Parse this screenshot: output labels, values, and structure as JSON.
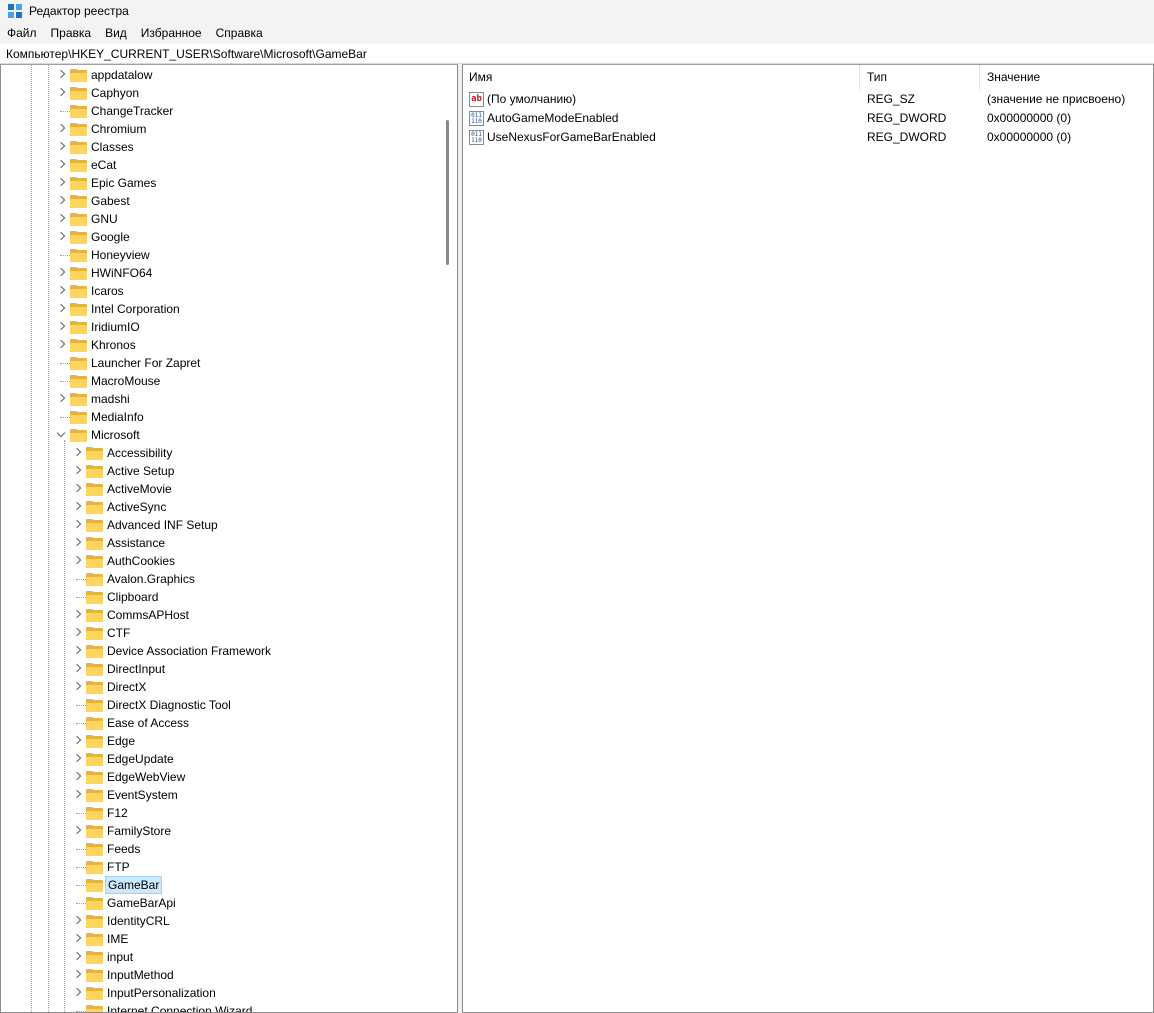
{
  "window": {
    "title": "Редактор реестра"
  },
  "menu": [
    "Файл",
    "Правка",
    "Вид",
    "Избранное",
    "Справка"
  ],
  "address": "Компьютер\\HKEY_CURRENT_USER\\Software\\Microsoft\\GameBar",
  "tree": {
    "top_level": [
      {
        "label": "appdatalow",
        "expander": "collapsed"
      },
      {
        "label": "Caphyon",
        "expander": "collapsed"
      },
      {
        "label": "ChangeTracker",
        "expander": "none"
      },
      {
        "label": "Chromium",
        "expander": "collapsed"
      },
      {
        "label": "Classes",
        "expander": "collapsed"
      },
      {
        "label": "eCat",
        "expander": "collapsed"
      },
      {
        "label": "Epic Games",
        "expander": "collapsed"
      },
      {
        "label": "Gabest",
        "expander": "collapsed"
      },
      {
        "label": "GNU",
        "expander": "collapsed"
      },
      {
        "label": "Google",
        "expander": "collapsed"
      },
      {
        "label": "Honeyview",
        "expander": "none"
      },
      {
        "label": "HWiNFO64",
        "expander": "collapsed"
      },
      {
        "label": "Icaros",
        "expander": "collapsed"
      },
      {
        "label": "Intel Corporation",
        "expander": "collapsed"
      },
      {
        "label": "IridiumIO",
        "expander": "collapsed"
      },
      {
        "label": "Khronos",
        "expander": "collapsed"
      },
      {
        "label": "Launcher For Zapret",
        "expander": "none"
      },
      {
        "label": "MacroMouse",
        "expander": "none"
      },
      {
        "label": "madshi",
        "expander": "collapsed"
      },
      {
        "label": "MediaInfo",
        "expander": "none"
      },
      {
        "label": "Microsoft",
        "expander": "expanded"
      }
    ],
    "microsoft_children": [
      {
        "label": "Accessibility",
        "expander": "collapsed"
      },
      {
        "label": "Active Setup",
        "expander": "collapsed"
      },
      {
        "label": "ActiveMovie",
        "expander": "collapsed"
      },
      {
        "label": "ActiveSync",
        "expander": "collapsed"
      },
      {
        "label": "Advanced INF Setup",
        "expander": "collapsed"
      },
      {
        "label": "Assistance",
        "expander": "collapsed"
      },
      {
        "label": "AuthCookies",
        "expander": "collapsed"
      },
      {
        "label": "Avalon.Graphics",
        "expander": "none"
      },
      {
        "label": "Clipboard",
        "expander": "none"
      },
      {
        "label": "CommsAPHost",
        "expander": "collapsed"
      },
      {
        "label": "CTF",
        "expander": "collapsed"
      },
      {
        "label": "Device Association Framework",
        "expander": "collapsed"
      },
      {
        "label": "DirectInput",
        "expander": "collapsed"
      },
      {
        "label": "DirectX",
        "expander": "collapsed"
      },
      {
        "label": "DirectX Diagnostic Tool",
        "expander": "none"
      },
      {
        "label": "Ease of Access",
        "expander": "none"
      },
      {
        "label": "Edge",
        "expander": "collapsed"
      },
      {
        "label": "EdgeUpdate",
        "expander": "collapsed"
      },
      {
        "label": "EdgeWebView",
        "expander": "collapsed"
      },
      {
        "label": "EventSystem",
        "expander": "collapsed"
      },
      {
        "label": "F12",
        "expander": "none"
      },
      {
        "label": "FamilyStore",
        "expander": "collapsed"
      },
      {
        "label": "Feeds",
        "expander": "none"
      },
      {
        "label": "FTP",
        "expander": "none"
      },
      {
        "label": "GameBar",
        "expander": "none",
        "selected": true
      },
      {
        "label": "GameBarApi",
        "expander": "none"
      },
      {
        "label": "IdentityCRL",
        "expander": "collapsed"
      },
      {
        "label": "IME",
        "expander": "collapsed"
      },
      {
        "label": "input",
        "expander": "collapsed"
      },
      {
        "label": "InputMethod",
        "expander": "collapsed"
      },
      {
        "label": "InputPersonalization",
        "expander": "collapsed"
      },
      {
        "label": "Internet Connection Wizard",
        "expander": "none"
      }
    ]
  },
  "list": {
    "columns": [
      "Имя",
      "Тип",
      "Значение"
    ],
    "rows": [
      {
        "icon": "string-value-icon",
        "name": "(По умолчанию)",
        "type": "REG_SZ",
        "value": "(значение не присвоено)"
      },
      {
        "icon": "dword-value-icon",
        "name": "AutoGameModeEnabled",
        "type": "REG_DWORD",
        "value": "0x00000000 (0)"
      },
      {
        "icon": "dword-value-icon",
        "name": "UseNexusForGameBarEnabled",
        "type": "REG_DWORD",
        "value": "0x00000000 (0)"
      }
    ]
  },
  "icons": {
    "sz_glyph": "ab",
    "dword_glyph": "011 110"
  },
  "colors": {
    "selection_bg": "#cce8ff",
    "selection_border": "#99d1ff",
    "folder": "#fcd460"
  }
}
